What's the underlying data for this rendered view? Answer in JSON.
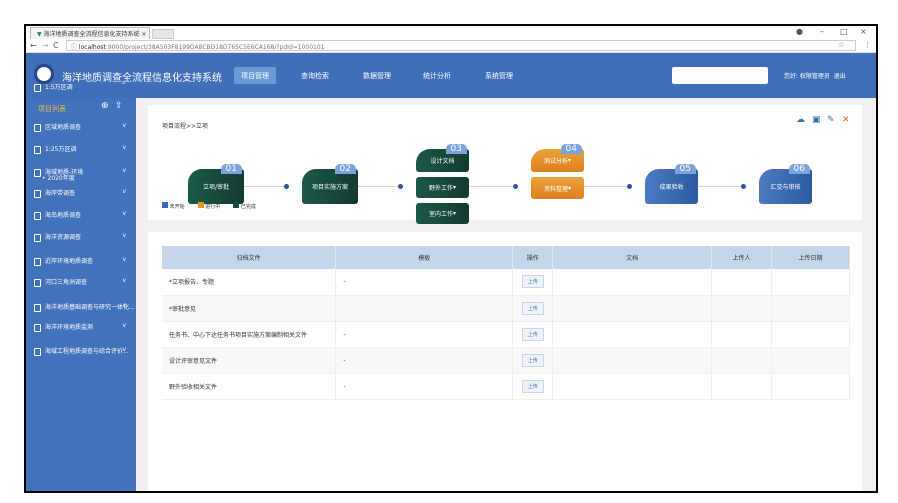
{
  "browser": {
    "tab_title": "海洋地质调查全流程信息化支持系统",
    "url_host": "localhost",
    "url_path": ":9000/project/38A503F8199DA8CBD18D765C5E6CA168/?pdId=1000101"
  },
  "header": {
    "system_title": "海洋地质调查全流程信息化支持系统",
    "nav": [
      {
        "label": "项目管理",
        "active": true
      },
      {
        "label": "查询检索"
      },
      {
        "label": "数据管理"
      },
      {
        "label": "统计分析"
      },
      {
        "label": "系统管理"
      }
    ],
    "search_placeholder": "",
    "user_text": "您好: 权限管理员",
    "logout": "退出"
  },
  "sidebar": {
    "title": "项目列表",
    "items": [
      {
        "label": "1:5万区调",
        "expanded": true,
        "children": [
          "2020年度"
        ]
      },
      {
        "label": "区域地质调查",
        "expanded": false
      },
      {
        "label": "1:25万区调",
        "expanded": false
      },
      {
        "label": "海域地质-环境",
        "expanded": false
      },
      {
        "label": "海岸带调查",
        "expanded": false
      },
      {
        "label": "海岛地质调查",
        "expanded": false
      },
      {
        "label": "海洋资源调查",
        "expanded": false
      },
      {
        "label": "近岸环境地质调查",
        "expanded": false
      },
      {
        "label": "河口三角洲调查",
        "expanded": false
      },
      {
        "label": "海洋地质基础调查与研究一体化...",
        "expanded": false
      },
      {
        "label": "海洋环境地质监测",
        "expanded": false
      },
      {
        "label": "海域工程地质调查与综合评价...",
        "expanded": false
      }
    ]
  },
  "workflow": {
    "breadcrumb": "项目流程>>立项",
    "steps": [
      {
        "num": "01",
        "label": "立项/审批",
        "status": "done"
      },
      {
        "num": "02",
        "label": "项目实施方案",
        "status": "done"
      },
      {
        "num": "03",
        "label": "设计文档",
        "status": "done",
        "subs": [
          "野外工作",
          "室内工作"
        ]
      },
      {
        "num": "04",
        "label": "测试分析",
        "status": "in-progress",
        "subs": [
          "资料整理"
        ]
      },
      {
        "num": "05",
        "label": "成果验收",
        "status": "not-started"
      },
      {
        "num": "06",
        "label": "汇交与审核",
        "status": "not-started"
      }
    ],
    "legend": [
      {
        "label": "未开始",
        "color": "#3a6cb5"
      },
      {
        "label": "进行中",
        "color": "#e6952d"
      },
      {
        "label": "已完成",
        "color": "#17493c"
      }
    ],
    "tools": [
      "cloud-upload-icon",
      "save-icon",
      "edit-icon",
      "close-icon"
    ]
  },
  "table": {
    "columns": [
      "归档文件",
      "模板",
      "操作",
      "文档",
      "上传人",
      "上传日期"
    ],
    "rows": [
      {
        "name": "*立项报告、专题",
        "template": "-",
        "action": "上传",
        "doc": "",
        "uploader": "",
        "date": ""
      },
      {
        "name": "*审批意见",
        "template": "",
        "action": "上传",
        "doc": "",
        "uploader": "",
        "date": ""
      },
      {
        "name": "任务书、中心下达任务书项目实施方案编制相关文件",
        "template": "-",
        "action": "上传",
        "doc": "",
        "uploader": "",
        "date": ""
      },
      {
        "name": "设计评审意见文件",
        "template": "-",
        "action": "上传",
        "doc": "",
        "uploader": "",
        "date": ""
      },
      {
        "name": "野外验收相关文件",
        "template": "-",
        "action": "上传",
        "doc": "",
        "uploader": "",
        "date": ""
      }
    ]
  }
}
